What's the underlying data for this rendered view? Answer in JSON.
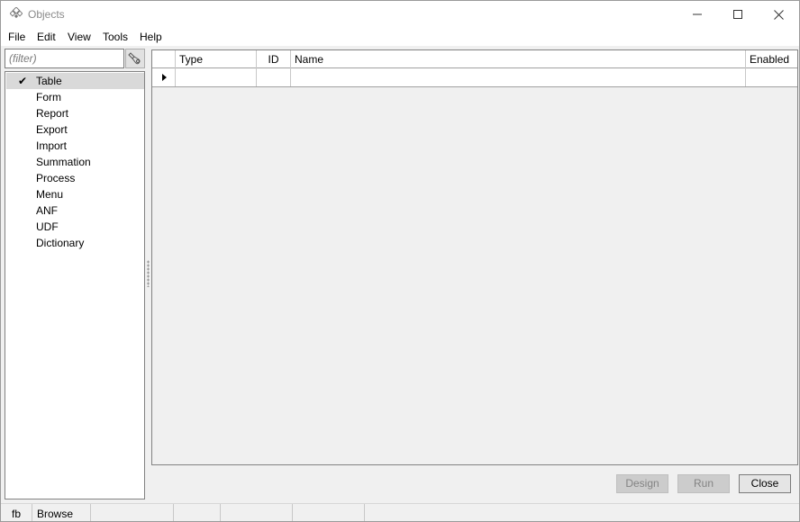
{
  "window": {
    "title": "Objects",
    "icon": "app-diamond-icon"
  },
  "menu": [
    "File",
    "Edit",
    "View",
    "Tools",
    "Help"
  ],
  "filter": {
    "value": "",
    "placeholder": "(filter)",
    "button_icon": "flashlight-icon"
  },
  "categories": {
    "items": [
      "Table",
      "Form",
      "Report",
      "Export",
      "Import",
      "Summation",
      "Process",
      "Menu",
      "ANF",
      "UDF",
      "Dictionary"
    ],
    "selected": "Table",
    "check_mark": "✔"
  },
  "grid": {
    "columns": [
      "",
      "Type",
      "ID",
      "Name",
      "Enabled"
    ],
    "rows": [
      [
        "",
        "",
        "",
        ""
      ]
    ]
  },
  "buttons": {
    "design": "Design",
    "run": "Run",
    "close": "Close"
  },
  "statusbar": [
    "fb",
    "Browse",
    "",
    "",
    "",
    "",
    ""
  ]
}
